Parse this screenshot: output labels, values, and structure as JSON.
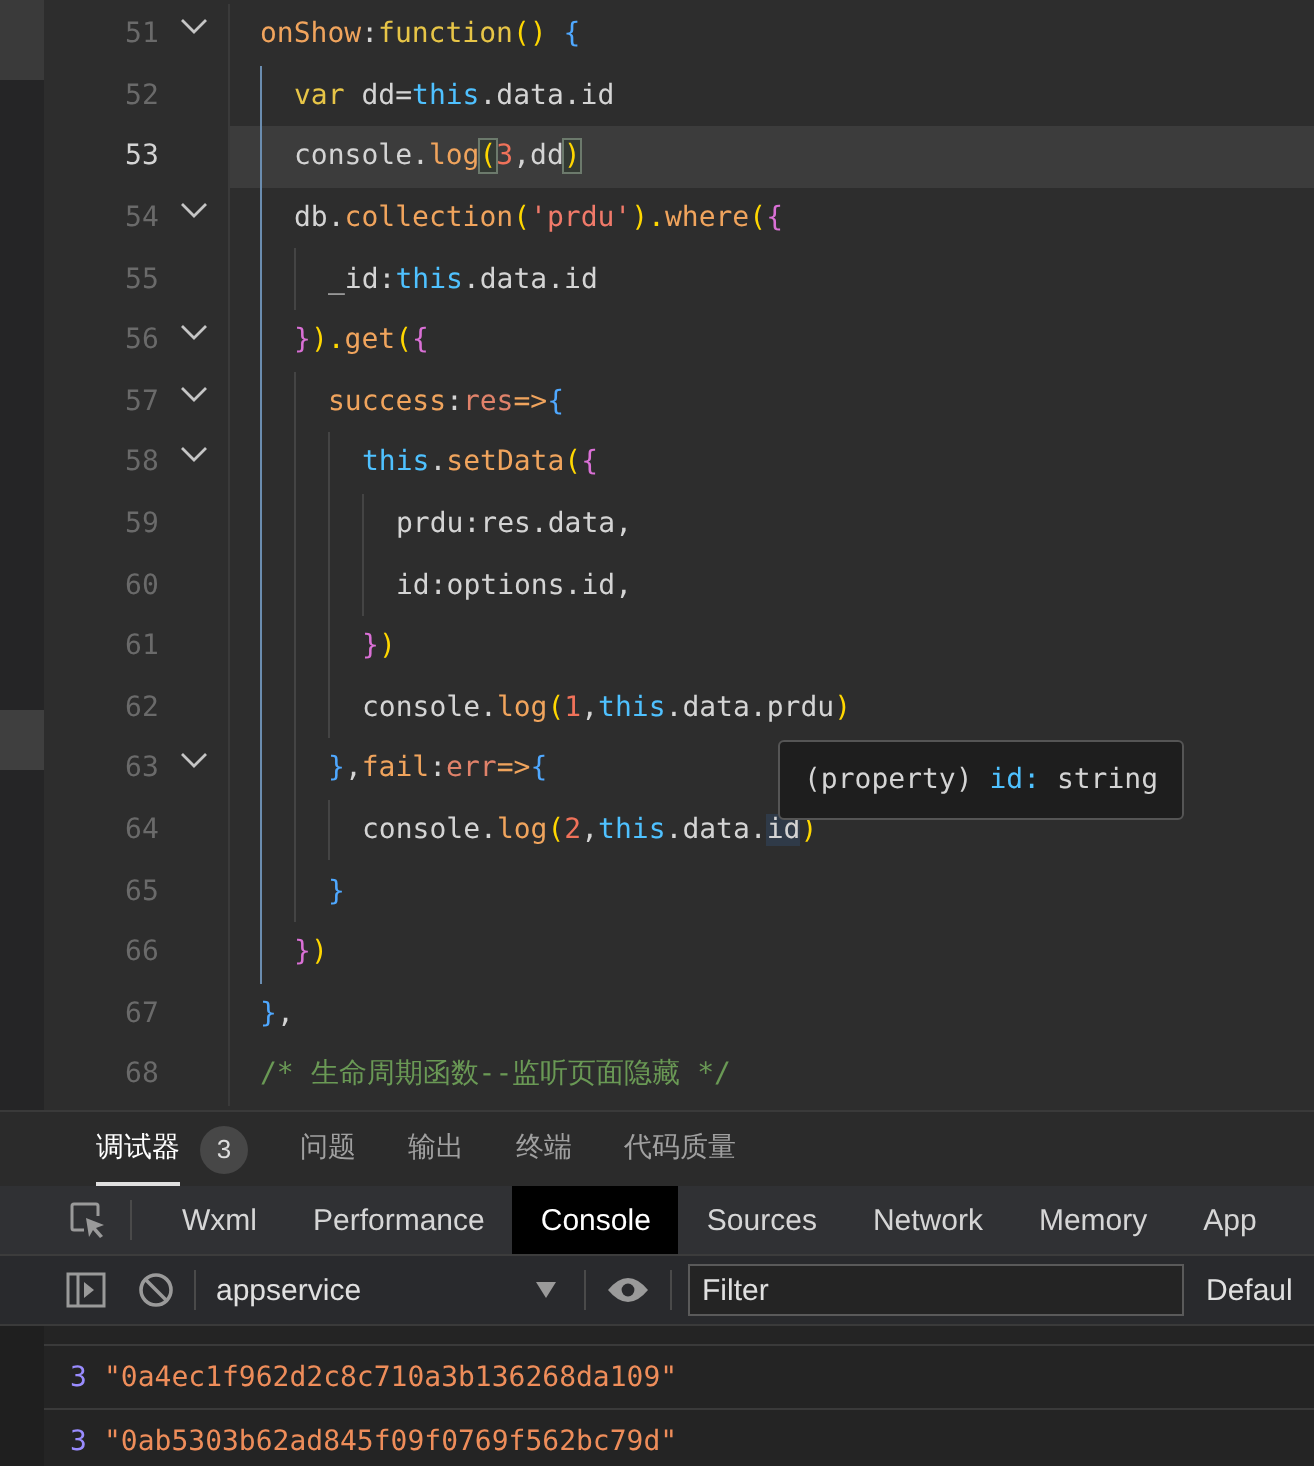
{
  "editor": {
    "lines": [
      {
        "number": "51",
        "foldable": true,
        "current": false,
        "tokens": [
          {
            "text": "onShow",
            "kind": "prop"
          },
          {
            "text": ":",
            "kind": "plain"
          },
          {
            "text": "function",
            "kind": "fn"
          },
          {
            "text": "() ",
            "kind": "paren-y"
          },
          {
            "text": "{",
            "kind": "paren-b"
          }
        ],
        "children": [
          {
            "number": "52",
            "foldable": false,
            "current": false,
            "tokens": [
              {
                "text": "var",
                "kind": "fn"
              },
              {
                "text": " dd=",
                "kind": "plain"
              },
              {
                "text": "this",
                "kind": "kw"
              },
              {
                "text": ".data.id",
                "kind": "plain"
              }
            ]
          },
          {
            "number": "53",
            "foldable": false,
            "current": true,
            "tokens": [
              {
                "text": "console.",
                "kind": "plain"
              },
              {
                "text": "log",
                "kind": "prop"
              },
              {
                "text": "(",
                "kind": "paren-y",
                "boxed": true
              },
              {
                "text": "3",
                "kind": "num"
              },
              {
                "text": ",dd",
                "kind": "plain"
              },
              {
                "text": ")",
                "kind": "paren-y",
                "boxed": true
              }
            ]
          },
          {
            "number": "54",
            "foldable": true,
            "current": false,
            "tokens": [
              {
                "text": "db.",
                "kind": "plain"
              },
              {
                "text": "collection",
                "kind": "prop"
              },
              {
                "text": "(",
                "kind": "paren-y"
              },
              {
                "text": "'prdu'",
                "kind": "str"
              },
              {
                "text": ").",
                "kind": "paren-y"
              },
              {
                "text": "where",
                "kind": "prop"
              },
              {
                "text": "(",
                "kind": "paren-y"
              },
              {
                "text": "{",
                "kind": "paren-p"
              }
            ],
            "children": [
              {
                "number": "55",
                "foldable": false,
                "current": false,
                "tokens": [
                  {
                    "text": "_id:",
                    "kind": "plain"
                  },
                  {
                    "text": "this",
                    "kind": "kw"
                  },
                  {
                    "text": ".data.id",
                    "kind": "plain"
                  }
                ]
              }
            ]
          },
          {
            "number": "56",
            "foldable": true,
            "current": false,
            "tokens": [
              {
                "text": "}",
                "kind": "paren-p"
              },
              {
                "text": ").",
                "kind": "paren-y"
              },
              {
                "text": "get",
                "kind": "prop"
              },
              {
                "text": "(",
                "kind": "paren-y"
              },
              {
                "text": "{",
                "kind": "paren-p"
              }
            ],
            "children": [
              {
                "number": "57",
                "foldable": true,
                "current": false,
                "tokens": [
                  {
                    "text": "success",
                    "kind": "prop"
                  },
                  {
                    "text": ":",
                    "kind": "plain"
                  },
                  {
                    "text": "res",
                    "kind": "param"
                  },
                  {
                    "text": "=>",
                    "kind": "prop"
                  },
                  {
                    "text": "{",
                    "kind": "paren-b"
                  }
                ],
                "children": [
                  {
                    "number": "58",
                    "foldable": true,
                    "current": false,
                    "tokens": [
                      {
                        "text": "this",
                        "kind": "kw"
                      },
                      {
                        "text": ".",
                        "kind": "plain"
                      },
                      {
                        "text": "setData",
                        "kind": "prop"
                      },
                      {
                        "text": "(",
                        "kind": "paren-y"
                      },
                      {
                        "text": "{",
                        "kind": "paren-p"
                      }
                    ],
                    "children": [
                      {
                        "number": "59",
                        "foldable": false,
                        "current": false,
                        "tokens": [
                          {
                            "text": "prdu:res.data,",
                            "kind": "plain"
                          }
                        ]
                      },
                      {
                        "number": "60",
                        "foldable": false,
                        "current": false,
                        "tokens": [
                          {
                            "text": "id:options.id,",
                            "kind": "plain"
                          }
                        ]
                      }
                    ]
                  },
                  {
                    "number": "61",
                    "foldable": false,
                    "current": false,
                    "tokens": [
                      {
                        "text": "}",
                        "kind": "paren-p"
                      },
                      {
                        "text": ")",
                        "kind": "paren-y"
                      }
                    ]
                  },
                  {
                    "number": "62",
                    "foldable": false,
                    "current": false,
                    "tokens": [
                      {
                        "text": "console.",
                        "kind": "plain"
                      },
                      {
                        "text": "log",
                        "kind": "prop"
                      },
                      {
                        "text": "(",
                        "kind": "paren-y"
                      },
                      {
                        "text": "1",
                        "kind": "num"
                      },
                      {
                        "text": ",",
                        "kind": "plain"
                      },
                      {
                        "text": "this",
                        "kind": "kw"
                      },
                      {
                        "text": ".data.prdu",
                        "kind": "plain"
                      },
                      {
                        "text": ")",
                        "kind": "paren-y"
                      }
                    ]
                  }
                ]
              },
              {
                "number": "63",
                "foldable": true,
                "current": false,
                "tokens": [
                  {
                    "text": "}",
                    "kind": "paren-b"
                  },
                  {
                    "text": ",",
                    "kind": "plain"
                  },
                  {
                    "text": "fail",
                    "kind": "prop"
                  },
                  {
                    "text": ":",
                    "kind": "plain"
                  },
                  {
                    "text": "err",
                    "kind": "param"
                  },
                  {
                    "text": "=>",
                    "kind": "prop"
                  },
                  {
                    "text": "{",
                    "kind": "paren-b"
                  }
                ],
                "children": [
                  {
                    "number": "64",
                    "foldable": false,
                    "current": false,
                    "tokens": [
                      {
                        "text": "console.",
                        "kind": "plain"
                      },
                      {
                        "text": "log",
                        "kind": "prop"
                      },
                      {
                        "text": "(",
                        "kind": "paren-y"
                      },
                      {
                        "text": "2",
                        "kind": "num"
                      },
                      {
                        "text": ",",
                        "kind": "plain"
                      },
                      {
                        "text": "this",
                        "kind": "kw"
                      },
                      {
                        "text": ".data.",
                        "kind": "plain"
                      },
                      {
                        "text": "id",
                        "kind": "plain",
                        "highlighted": true
                      },
                      {
                        "text": ")",
                        "kind": "paren-y"
                      }
                    ]
                  }
                ]
              },
              {
                "number": "65",
                "foldable": false,
                "current": false,
                "tokens": [
                  {
                    "text": "}",
                    "kind": "paren-b"
                  }
                ]
              }
            ]
          },
          {
            "number": "66",
            "foldable": false,
            "current": false,
            "tokens": [
              {
                "text": "}",
                "kind": "paren-p"
              },
              {
                "text": ")",
                "kind": "paren-y"
              }
            ]
          }
        ]
      },
      {
        "number": "67",
        "foldable": false,
        "current": false,
        "tokens": [
          {
            "text": "}",
            "kind": "paren-b"
          },
          {
            "text": ",",
            "kind": "plain"
          }
        ]
      },
      {
        "number": "68",
        "foldable": false,
        "current": false,
        "tokens": [
          {
            "text": "/* 生命周期函数--监听页面隐藏 */",
            "kind": "comment"
          }
        ]
      }
    ],
    "tooltip": [
      {
        "text": "(property) ",
        "kind": "plain"
      },
      {
        "text": "id:",
        "kind": "kw"
      },
      {
        "text": " string",
        "kind": "plain"
      }
    ]
  },
  "panel_tabs": [
    {
      "label": "调试器",
      "selected": true,
      "badge": "3"
    },
    {
      "label": "问题",
      "selected": false
    },
    {
      "label": "输出",
      "selected": false
    },
    {
      "label": "终端",
      "selected": false
    },
    {
      "label": "代码质量",
      "selected": false
    }
  ],
  "devtools_tabs": [
    {
      "label": "Wxml",
      "selected": false
    },
    {
      "label": "Performance",
      "selected": false
    },
    {
      "label": "Console",
      "selected": true
    },
    {
      "label": "Sources",
      "selected": false
    },
    {
      "label": "Network",
      "selected": false
    },
    {
      "label": "Memory",
      "selected": false
    },
    {
      "label": "App",
      "selected": false
    }
  ],
  "console_toolbar": {
    "context": "appservice",
    "filter_placeholder": "Filter",
    "levels": "Defaul"
  },
  "console_rows": [
    {
      "count": "3",
      "value": "\"0a4ec1f962d2c8c710a3b136268da109\""
    },
    {
      "count": "3",
      "value": "\"0ab5303b62ad845f09f0769f562bc79d\""
    }
  ]
}
